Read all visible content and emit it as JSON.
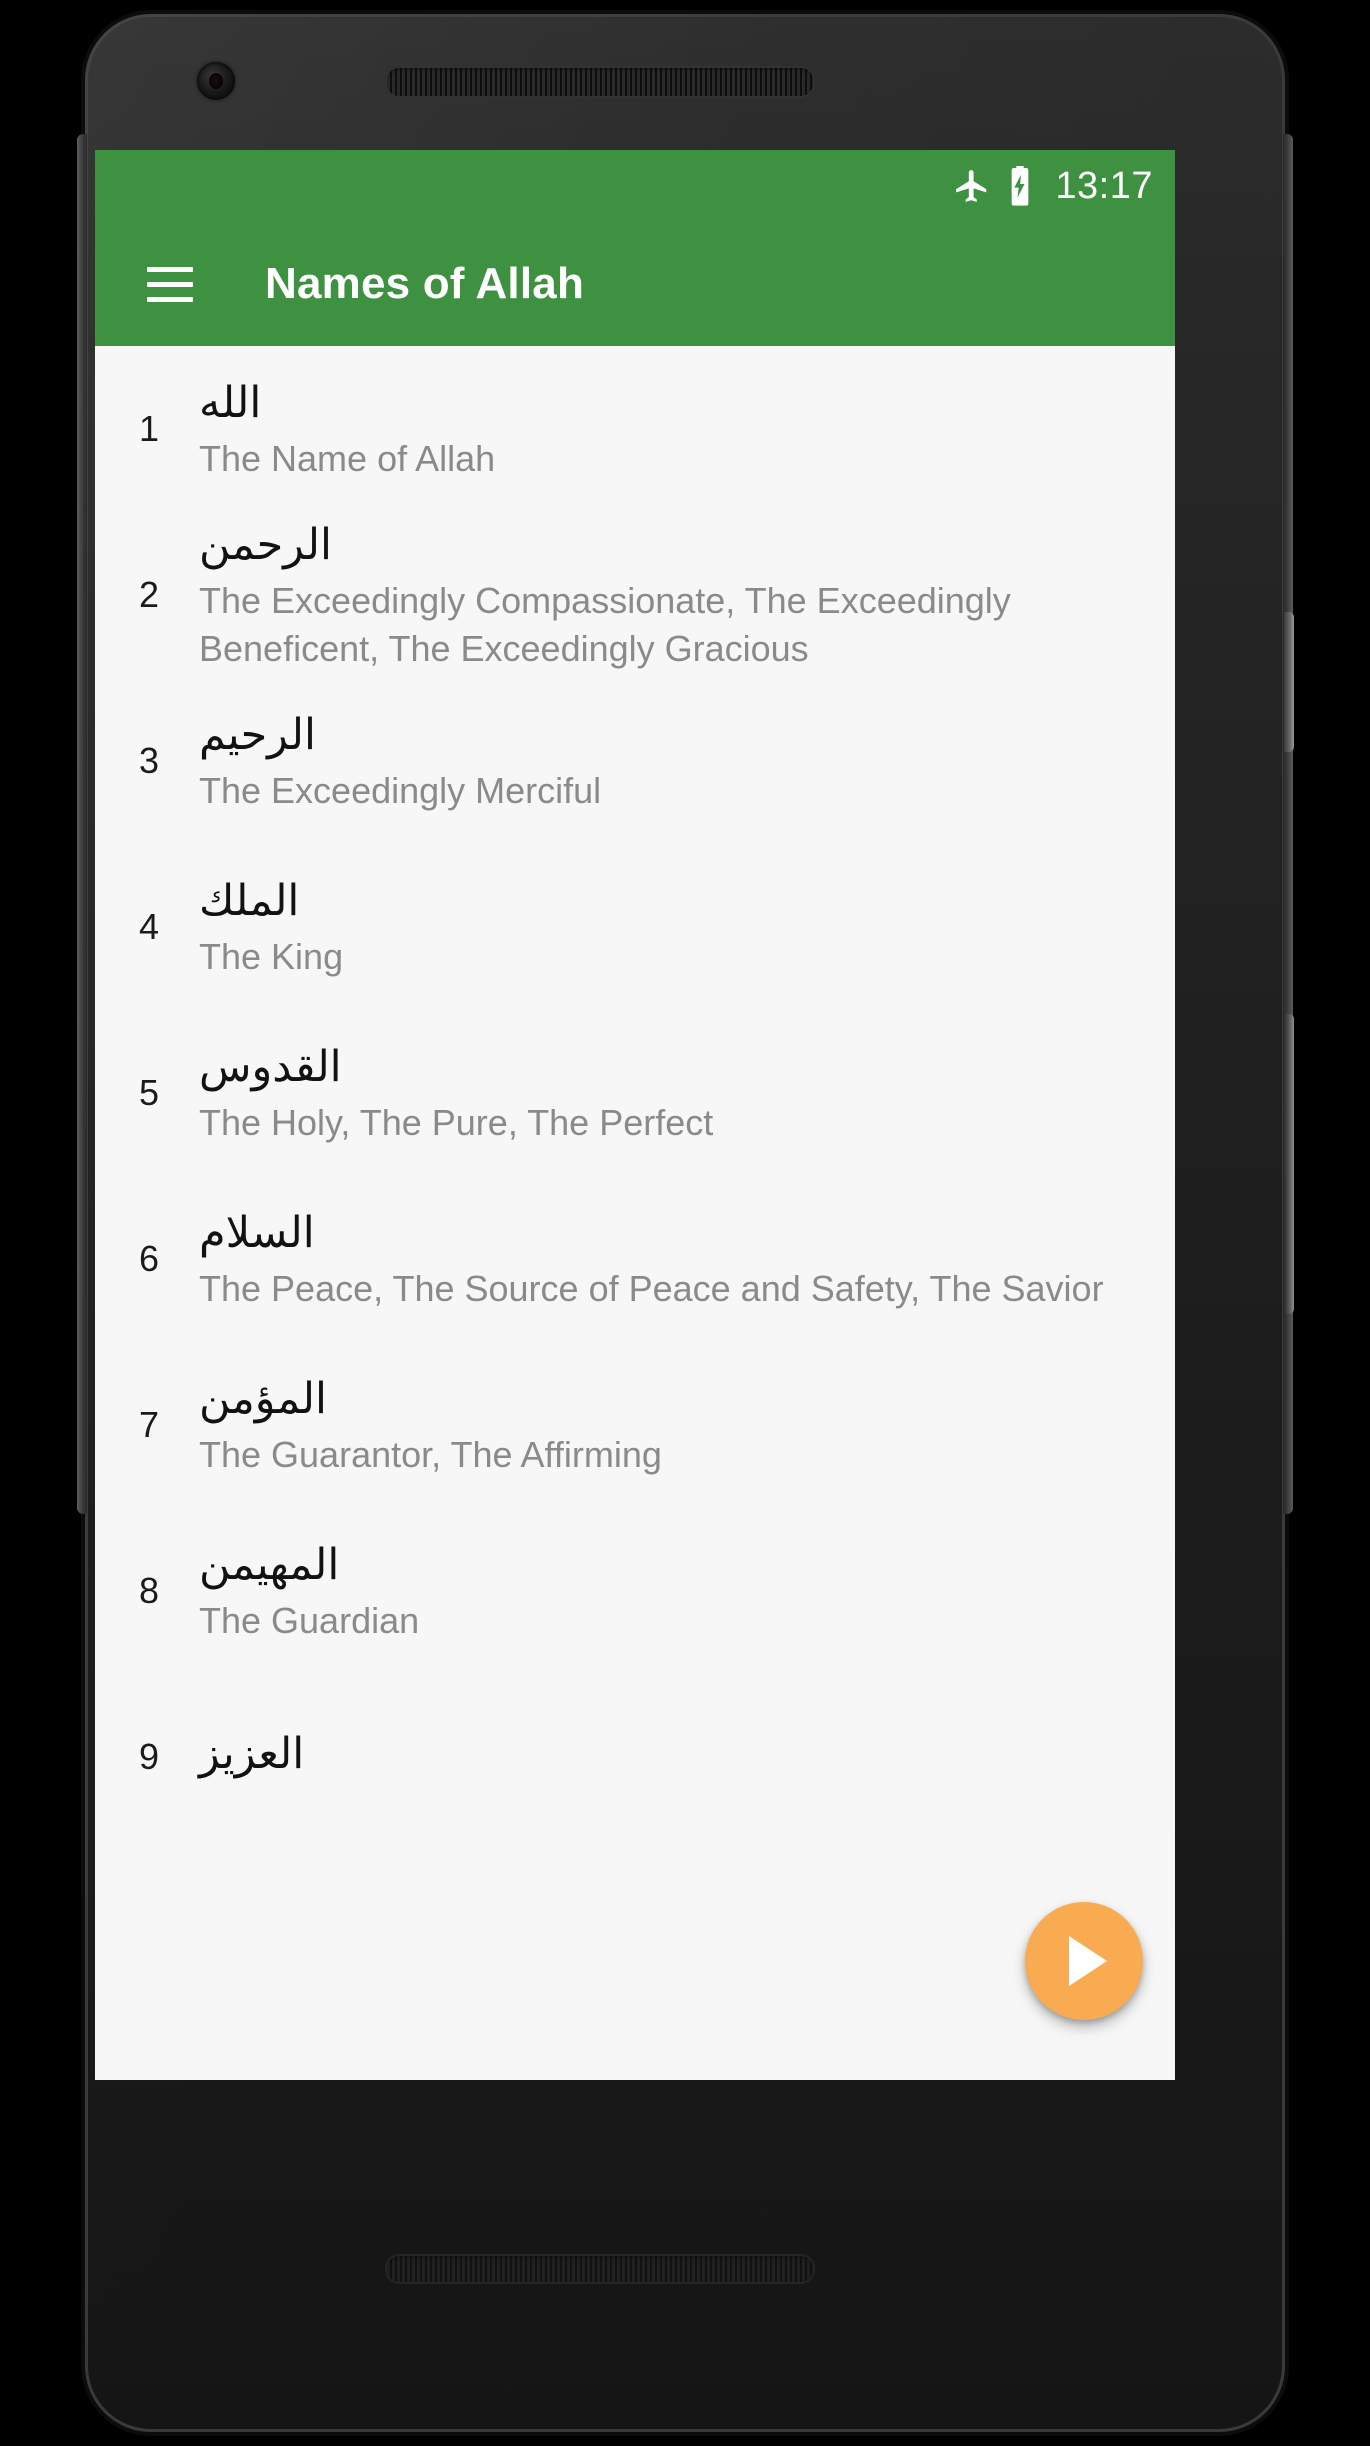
{
  "device": {
    "hardware": {
      "front_camera": "front-camera",
      "earpiece": "earpiece-speaker-grille",
      "bottom_speaker": "bottom-speaker-grille",
      "power_button": "power-button",
      "volume_rocker": "volume-rocker"
    }
  },
  "status_bar": {
    "time": "13:17",
    "icons": [
      "airplane-mode-icon",
      "battery-charging-icon"
    ],
    "background_color": "#3f9142"
  },
  "app_bar": {
    "menu_icon": "hamburger-menu-icon",
    "title": "Names of Allah",
    "background_color": "#3f9142",
    "text_color": "#ffffff"
  },
  "list": {
    "background_color": "#f7f7f7",
    "index_color": "#1b1b1b",
    "arabic_color": "#121212",
    "meaning_color": "#8a8a8a",
    "items": [
      {
        "index": "1",
        "arabic": "الله",
        "meaning": "The Name of Allah"
      },
      {
        "index": "2",
        "arabic": "الرحمن",
        "meaning": "The Exceedingly Compassionate, The Exceedingly Beneficent, The Exceedingly Gracious"
      },
      {
        "index": "3",
        "arabic": "الرحيم",
        "meaning": "The Exceedingly Merciful"
      },
      {
        "index": "4",
        "arabic": "الملك",
        "meaning": "The King"
      },
      {
        "index": "5",
        "arabic": "القدوس",
        "meaning": "The Holy, The Pure, The Perfect"
      },
      {
        "index": "6",
        "arabic": "السلام",
        "meaning": "The Peace, The Source of Peace and Safety, The Savior"
      },
      {
        "index": "7",
        "arabic": "المؤمن",
        "meaning": "The Guarantor, The Affirming"
      },
      {
        "index": "8",
        "arabic": "المهيمن",
        "meaning": "The Guardian"
      },
      {
        "index": "9",
        "arabic": "العزيز",
        "meaning": ""
      }
    ]
  },
  "fab": {
    "icon": "play-icon",
    "color": "#f9ab51",
    "icon_color": "#ffffff"
  },
  "nav_bar": {
    "background_color": "#000000",
    "buttons": [
      {
        "name": "back",
        "icon": "back-triangle-icon"
      },
      {
        "name": "home",
        "icon": "home-circle-icon"
      },
      {
        "name": "recents",
        "icon": "recents-square-icon"
      }
    ]
  }
}
